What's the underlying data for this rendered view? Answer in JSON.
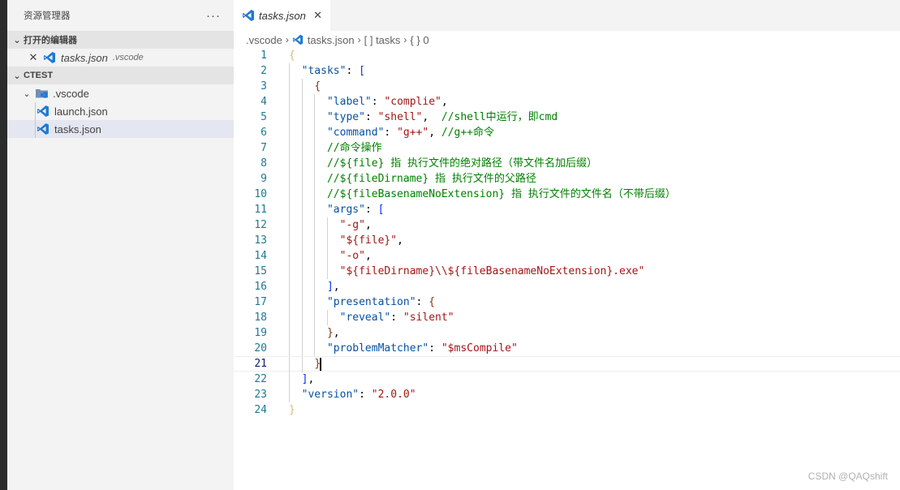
{
  "explorer": {
    "title": "资源管理器",
    "more": "···",
    "open_editors": {
      "header": "打开的编辑器",
      "items": [
        {
          "name": "tasks.json",
          "dir": ".vscode"
        }
      ]
    },
    "workspace": {
      "header": "CTEST",
      "folder": ".vscode",
      "files": [
        "launch.json",
        "tasks.json"
      ],
      "selected_file": "tasks.json"
    }
  },
  "editor": {
    "tab": {
      "label": "tasks.json",
      "close": "✕"
    },
    "breadcrumb": [
      ".vscode",
      "tasks.json",
      "[ ] tasks",
      "{ } 0"
    ],
    "cursor_line": 21,
    "lines": [
      [
        [
          "b1",
          "{"
        ]
      ],
      [
        [
          "pun",
          "  "
        ],
        [
          "key",
          "\"tasks\""
        ],
        [
          "pun",
          ": "
        ],
        [
          "b2",
          "["
        ]
      ],
      [
        [
          "pun",
          "    "
        ],
        [
          "b3",
          "{"
        ]
      ],
      [
        [
          "pun",
          "      "
        ],
        [
          "key",
          "\"label\""
        ],
        [
          "pun",
          ": "
        ],
        [
          "str",
          "\"complie\""
        ],
        [
          "pun",
          ","
        ]
      ],
      [
        [
          "pun",
          "      "
        ],
        [
          "key",
          "\"type\""
        ],
        [
          "pun",
          ": "
        ],
        [
          "str",
          "\"shell\""
        ],
        [
          "pun",
          ",  "
        ],
        [
          "com",
          "//shell中运行，即cmd"
        ]
      ],
      [
        [
          "pun",
          "      "
        ],
        [
          "key",
          "\"command\""
        ],
        [
          "pun",
          ": "
        ],
        [
          "str",
          "\"g++\""
        ],
        [
          "pun",
          ", "
        ],
        [
          "com",
          "//g++命令"
        ]
      ],
      [
        [
          "pun",
          "      "
        ],
        [
          "com",
          "//命令操作"
        ]
      ],
      [
        [
          "pun",
          "      "
        ],
        [
          "com",
          "//${file} 指 执行文件的绝对路径（带文件名加后缀）"
        ]
      ],
      [
        [
          "pun",
          "      "
        ],
        [
          "com",
          "//${fileDirname} 指 执行文件的父路径"
        ]
      ],
      [
        [
          "pun",
          "      "
        ],
        [
          "com",
          "//${fileBasenameNoExtension} 指 执行文件的文件名（不带后缀）"
        ]
      ],
      [
        [
          "pun",
          "      "
        ],
        [
          "key",
          "\"args\""
        ],
        [
          "pun",
          ": "
        ],
        [
          "b2",
          "["
        ]
      ],
      [
        [
          "pun",
          "        "
        ],
        [
          "str",
          "\"-g\""
        ],
        [
          "pun",
          ","
        ]
      ],
      [
        [
          "pun",
          "        "
        ],
        [
          "str",
          "\"${file}\""
        ],
        [
          "pun",
          ","
        ]
      ],
      [
        [
          "pun",
          "        "
        ],
        [
          "str",
          "\"-o\""
        ],
        [
          "pun",
          ","
        ]
      ],
      [
        [
          "pun",
          "        "
        ],
        [
          "str",
          "\"${fileDirname}\\\\${fileBasenameNoExtension}.exe\""
        ]
      ],
      [
        [
          "pun",
          "      "
        ],
        [
          "b2",
          "]"
        ],
        [
          "pun",
          ","
        ]
      ],
      [
        [
          "pun",
          "      "
        ],
        [
          "key",
          "\"presentation\""
        ],
        [
          "pun",
          ": "
        ],
        [
          "b3",
          "{"
        ]
      ],
      [
        [
          "pun",
          "        "
        ],
        [
          "key",
          "\"reveal\""
        ],
        [
          "pun",
          ": "
        ],
        [
          "str",
          "\"silent\""
        ]
      ],
      [
        [
          "pun",
          "      "
        ],
        [
          "b3",
          "}"
        ],
        [
          "pun",
          ","
        ]
      ],
      [
        [
          "pun",
          "      "
        ],
        [
          "key",
          "\"problemMatcher\""
        ],
        [
          "pun",
          ": "
        ],
        [
          "str",
          "\"$msCompile\""
        ]
      ],
      [
        [
          "pun",
          "    "
        ],
        [
          "b3",
          "}"
        ]
      ],
      [
        [
          "pun",
          "  "
        ],
        [
          "b2",
          "]"
        ],
        [
          "pun",
          ","
        ]
      ],
      [
        [
          "pun",
          "  "
        ],
        [
          "key",
          "\"version\""
        ],
        [
          "pun",
          ": "
        ],
        [
          "str",
          "\"2.0.0\""
        ]
      ],
      [
        [
          "b1",
          "}"
        ]
      ]
    ]
  },
  "watermark": "CSDN @QAQshift",
  "colors": {
    "sidebar_bg": "#f3f3f3",
    "section_bg": "#e4e4e4",
    "selected_row": "#e4e6f1",
    "key": "#0451a5",
    "string": "#a31515",
    "comment": "#008000",
    "line_number": "#237893",
    "vscode_blue": "#1f7ad3"
  }
}
